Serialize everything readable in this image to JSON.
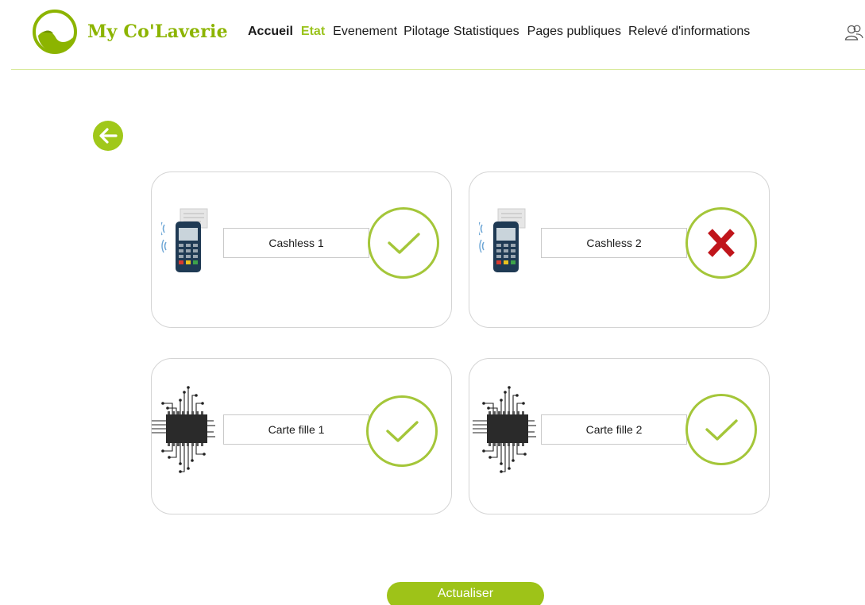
{
  "header": {
    "brand": "My Co'Laverie",
    "nav": [
      {
        "label": "Accueil"
      },
      {
        "label": "Etat"
      },
      {
        "label": "Evenement"
      },
      {
        "label": "Pilotage"
      },
      {
        "label": "Statistiques"
      },
      {
        "label": "Pages publiques"
      },
      {
        "label": "Relevé d'informations"
      }
    ],
    "active_nav": "Etat",
    "user_icon": "users-icon"
  },
  "back_icon": "arrow-left-icon",
  "devices": [
    {
      "label": "Cashless 1",
      "icon": "payment-terminal-icon",
      "status": "ok",
      "status_icon": "check-icon"
    },
    {
      "label": "Cashless 2",
      "icon": "payment-terminal-icon",
      "status": "error",
      "status_icon": "cross-icon"
    },
    {
      "label": "Carte fille 1",
      "icon": "chip-icon",
      "status": "ok",
      "status_icon": "check-icon"
    },
    {
      "label": "Carte fille 2",
      "icon": "chip-icon",
      "status": "ok",
      "status_icon": "check-icon"
    }
  ],
  "refresh_label": "Actualiser",
  "colors": {
    "brand": "#8cb400",
    "accent": "#a0c81a",
    "active_nav": "#9ac31c",
    "error": "#c0151b",
    "ring": "#a4c639"
  }
}
